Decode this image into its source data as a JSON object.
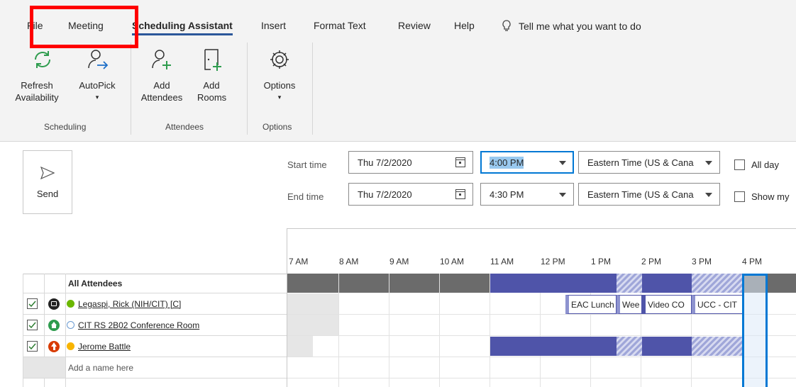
{
  "tabs": [
    "File",
    "Meeting",
    "Scheduling Assistant",
    "Insert",
    "Format Text",
    "Review",
    "Help"
  ],
  "tell_me": "Tell me what you want to do",
  "ribbon": {
    "refresh_label": "Refresh Availability",
    "autopick_label": "AutoPick",
    "add_attendees_label": "Add Attendees",
    "add_rooms_label": "Add Rooms",
    "options_label": "Options",
    "group_scheduling": "Scheduling",
    "group_attendees": "Attendees",
    "group_options": "Options"
  },
  "send_label": "Send",
  "start": {
    "label": "Start time",
    "date": "Thu 7/2/2020",
    "time": "4:00 PM",
    "timezone": "Eastern Time (US & Cana"
  },
  "end": {
    "label": "End time",
    "date": "Thu 7/2/2020",
    "time": "4:30 PM",
    "timezone": "Eastern Time (US & Cana"
  },
  "all_day_label": "All day",
  "show_my_label": "Show my",
  "hours": [
    "7 AM",
    "8 AM",
    "9 AM",
    "10 AM",
    "11 AM",
    "12 PM",
    "1 PM",
    "2 PM",
    "3 PM",
    "4 PM"
  ],
  "attendees_header": "All Attendees",
  "attendees": [
    {
      "name": "Legaspi, Rick (NIH/CIT) [C]",
      "status": "available"
    },
    {
      "name": "CIT RS 2B02 Conference Room",
      "status": "unknown"
    },
    {
      "name": "Jerome Battle",
      "status": "away"
    }
  ],
  "add_name_placeholder": "Add a name here",
  "events": [
    "EAC Lunch",
    "Wee",
    "Video CO",
    "UCC - CIT"
  ],
  "colors": {
    "accent": "#2b579a",
    "busy": "#4f54a9",
    "red_box": "#ff0000",
    "selection": "#0078d4"
  }
}
